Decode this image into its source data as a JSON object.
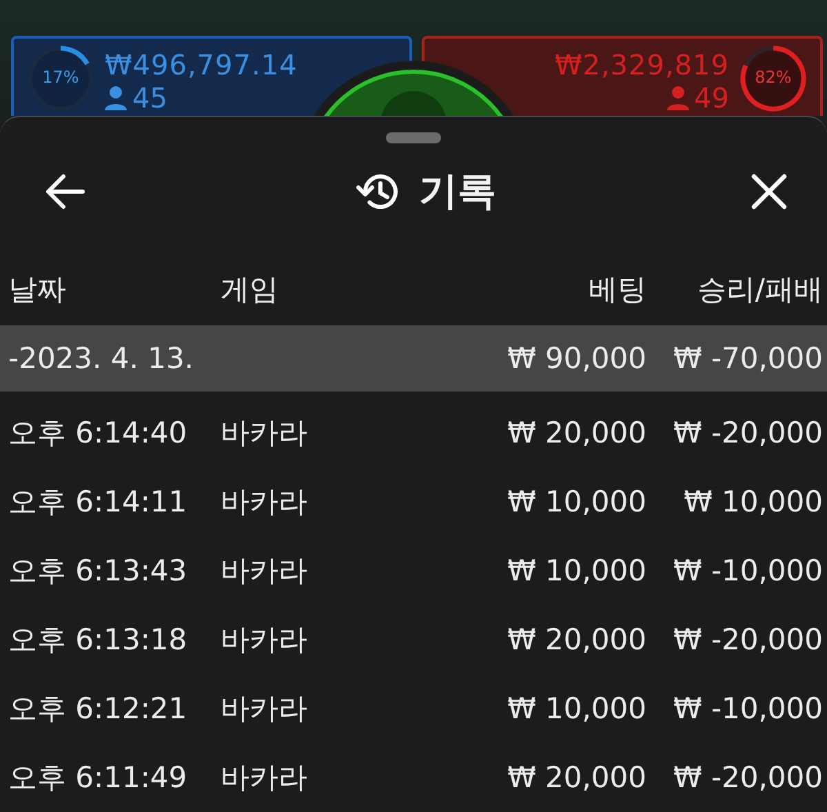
{
  "background": {
    "player_panel": {
      "percent": "17%",
      "amount": "₩496,797.14",
      "count": "45"
    },
    "banker_panel": {
      "percent": "82%",
      "amount": "₩2,329,819",
      "count": "49"
    }
  },
  "sheet": {
    "title": "기록"
  },
  "columns": [
    "날짜",
    "게임",
    "베팅",
    "승리/패배"
  ],
  "rows": [
    {
      "kind": "group",
      "date": "-2023. 4. 13.",
      "bet": "₩ 90,000",
      "result": "₩ -70,000"
    },
    {
      "kind": "entry",
      "time": "오후 6:14:40",
      "game": "바카라",
      "bet": "₩ 20,000",
      "result": "₩ -20,000"
    },
    {
      "kind": "entry",
      "time": "오후 6:14:11",
      "game": "바카라",
      "bet": "₩ 10,000",
      "result": "₩ 10,000"
    },
    {
      "kind": "entry",
      "time": "오후 6:13:43",
      "game": "바카라",
      "bet": "₩ 10,000",
      "result": "₩ -10,000"
    },
    {
      "kind": "entry",
      "time": "오후 6:13:18",
      "game": "바카라",
      "bet": "₩ 20,000",
      "result": "₩ -20,000"
    },
    {
      "kind": "entry",
      "time": "오후 6:12:21",
      "game": "바카라",
      "bet": "₩ 10,000",
      "result": "₩ -10,000"
    },
    {
      "kind": "entry",
      "time": "오후 6:11:49",
      "game": "바카라",
      "bet": "₩ 20,000",
      "result": "₩ -20,000"
    }
  ]
}
